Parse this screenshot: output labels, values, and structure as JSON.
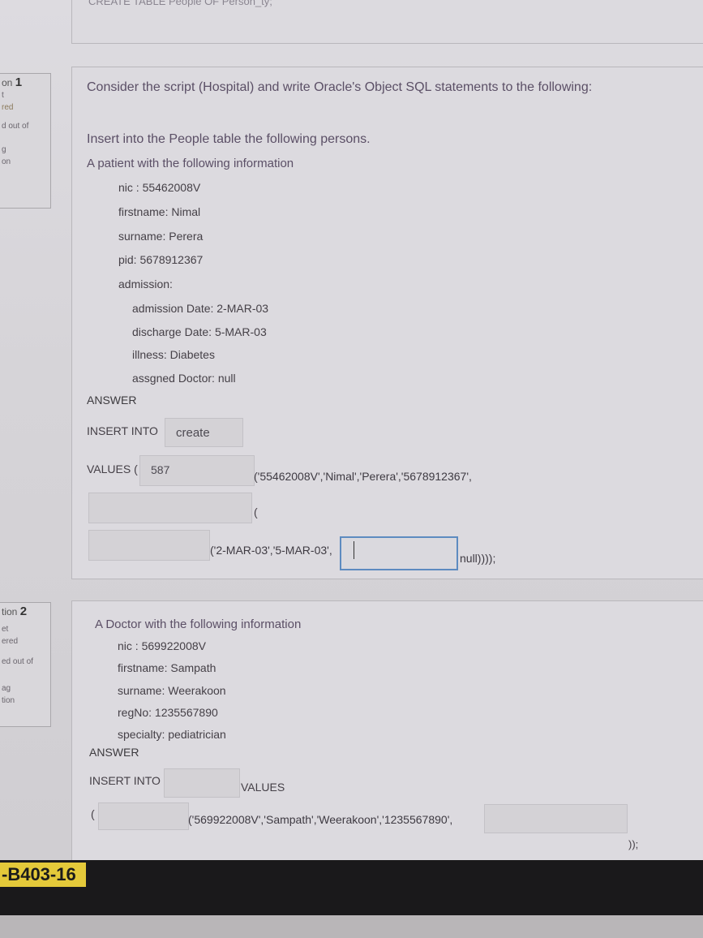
{
  "top_fragment": "CREATE TABLE People OF Person_ty;",
  "sidebar": {
    "q1": {
      "prefix": "on",
      "number": "1",
      "line1": "t",
      "line2": "red",
      "line3": "d out of",
      "line4": "g",
      "line5": "on"
    },
    "q2": {
      "prefix": "tion",
      "number": "2",
      "line1": "et",
      "line2": "ered",
      "line3": "ed out of",
      "line4": "ag",
      "line5": "tion"
    }
  },
  "q1": {
    "instruction": "Consider the script (Hospital) and write Oracle's Object SQL statements to the following:",
    "intro": "Insert into the People table the following persons.",
    "patient_intro": "A patient with the following information",
    "fields": {
      "nic": "nic : 55462008V",
      "firstname": "firstname: Nimal",
      "surname": "surname: Perera",
      "pid": "pid: 5678912367",
      "admission": "admission:",
      "admission_date": "admission Date: 2-MAR-03",
      "discharge_date": "discharge Date: 5-MAR-03",
      "illness": "illness: Diabetes",
      "doctor": "assgned Doctor: null"
    },
    "answer_label": "ANSWER",
    "insert_into": "INSERT INTO",
    "table_value": "create",
    "values_label": "VALUES (",
    "values_input": "587",
    "values_text": "('55462008V','Nimal','Perera','5678912367',",
    "paren": "(",
    "dates_text": "('2-MAR-03','5-MAR-03',",
    "null_text": "null))));"
  },
  "q2": {
    "intro": "A Doctor with the following information",
    "fields": {
      "nic": "nic : 569922008V",
      "firstname": "firstname: Sampath",
      "surname": "surname: Weerakoon",
      "regno": "regNo: 1235567890",
      "specialty": "specialty: pediatrician"
    },
    "answer_label": "ANSWER",
    "insert_into": "INSERT INTO",
    "values_label": "VALUES",
    "paren": "(",
    "values_text": "('569922008V','Sampath','Weerakoon','1235567890',",
    "end_text": "));"
  },
  "monitor_label": "-B403-16"
}
